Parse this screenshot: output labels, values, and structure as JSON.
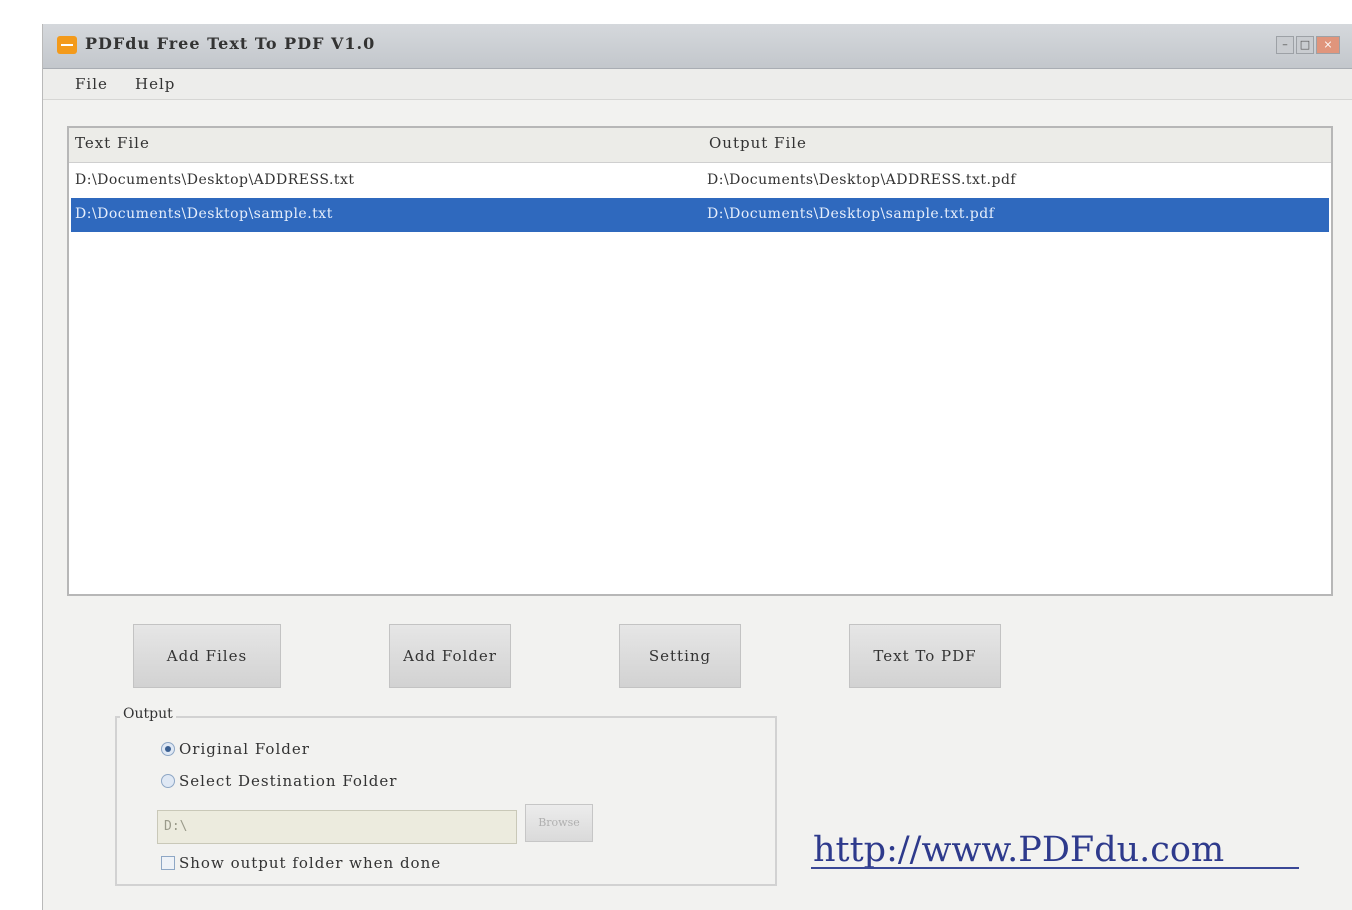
{
  "window": {
    "title": "PDFdu Free Text To PDF V1.0",
    "controls": [
      "minimize",
      "maximize",
      "close"
    ]
  },
  "menu": {
    "items": [
      {
        "label": "File"
      },
      {
        "label": "Help"
      }
    ]
  },
  "file_list": {
    "columns": [
      "Text File",
      "Output File"
    ],
    "rows": [
      {
        "text_file": "D:\\Documents\\Desktop\\ADDRESS.txt",
        "output_file": "D:\\Documents\\Desktop\\ADDRESS.txt.pdf",
        "selected": false
      },
      {
        "text_file": "D:\\Documents\\Desktop\\sample.txt",
        "output_file": "D:\\Documents\\Desktop\\sample.txt.pdf",
        "selected": true
      }
    ]
  },
  "buttons": {
    "add_files": "Add Files",
    "add_folder": "Add Folder",
    "setting": "Setting",
    "text_to_pdf": "Text To PDF"
  },
  "output": {
    "legend": "Output",
    "original_folder": "Original Folder",
    "select_destination": "Select Destination Folder",
    "selected_option": "original_folder",
    "destination_path": "D:\\",
    "browse_label": "Browse",
    "show_output_label": "Show output folder when done",
    "show_output_checked": false
  },
  "link": {
    "text": "http://www.PDFdu.com"
  },
  "colors": {
    "selection": "#2f69be",
    "link": "#2e3a8c",
    "app_icon": "#f39a1b"
  }
}
